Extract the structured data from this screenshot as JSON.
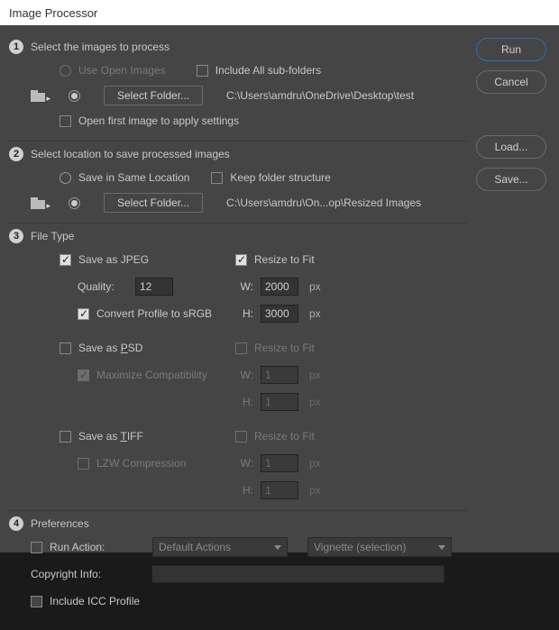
{
  "window": {
    "title": "Image Processor"
  },
  "buttons": {
    "run": "Run",
    "cancel": "Cancel",
    "load": "Load...",
    "save": "Save...",
    "select_folder": "Select Folder..."
  },
  "section1": {
    "num": "1",
    "title": "Select the images to process",
    "use_open": "Use Open Images",
    "include_sub": "Include All sub-folders",
    "path": "C:\\Users\\amdru\\OneDrive\\Desktop\\test",
    "open_first": "Open first image to apply settings"
  },
  "section2": {
    "num": "2",
    "title": "Select location to save processed images",
    "same_loc": "Save in Same Location",
    "keep_struct": "Keep folder structure",
    "path": "C:\\Users\\amdru\\On...op\\Resized Images"
  },
  "section3": {
    "num": "3",
    "title": "File Type",
    "jpeg": {
      "label": "Save as JPEG",
      "quality_label": "Quality:",
      "quality": "12",
      "convert": "Convert Profile to sRGB",
      "resize": "Resize to Fit",
      "w_label": "W:",
      "w": "2000",
      "h_label": "H:",
      "h": "3000",
      "unit": "px"
    },
    "psd": {
      "label_pre": "Save as ",
      "label_u": "P",
      "label_post": "SD",
      "max": "Maximize Compatibility",
      "resize": "Resize to Fit",
      "w_label": "W:",
      "w": "1",
      "h_label": "H:",
      "h": "1",
      "unit": "px"
    },
    "tiff": {
      "label_pre": "Save as ",
      "label_u": "T",
      "label_post": "IFF",
      "lzw": "LZW Compression",
      "resize": "Resize to Fit",
      "w_label": "W:",
      "w": "1",
      "h_label": "H:",
      "h": "1",
      "unit": "px"
    }
  },
  "section4": {
    "num": "4",
    "title": "Preferences",
    "run_action": "Run Action:",
    "action_set": "Default Actions",
    "action": "Vignette (selection)",
    "copyright": "Copyright Info:",
    "copyright_val": "",
    "icc": "Include ICC Profile"
  }
}
